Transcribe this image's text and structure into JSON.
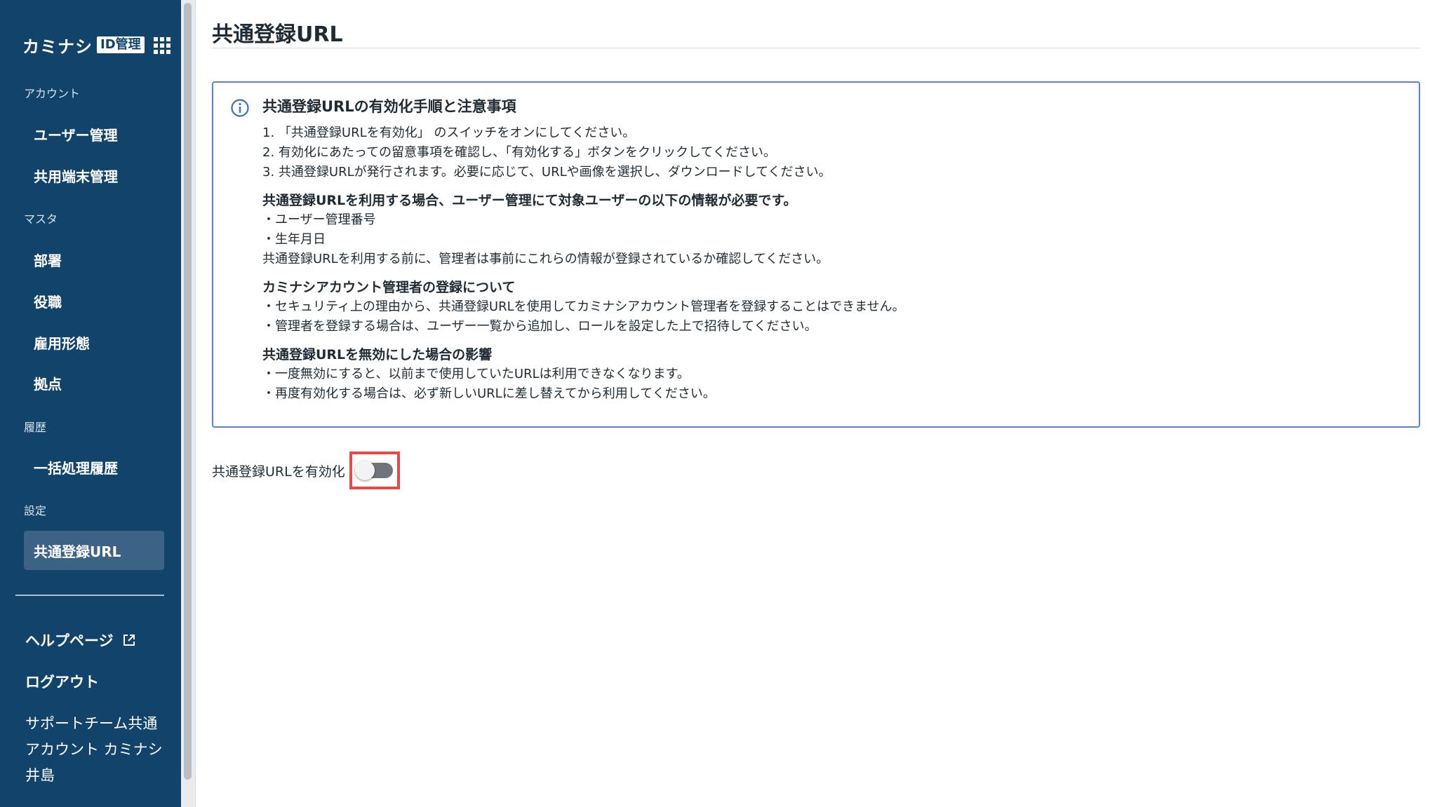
{
  "sidebar": {
    "logo_text": "カミナシ",
    "logo_badge": "ID管理",
    "apps_icon": "grid-icon",
    "sections": {
      "account": "アカウント",
      "master": "マスタ",
      "history": "履歴",
      "settings": "設定"
    },
    "items": {
      "user_management": "ユーザー管理",
      "shared_device_management": "共用端末管理",
      "department": "部署",
      "position": "役職",
      "employment_type": "雇用形態",
      "location": "拠点",
      "batch_history": "一括処理履歴",
      "shared_registration_url": "共通登録URL"
    },
    "active_item": "shared_registration_url",
    "help_page": "ヘルプページ",
    "logout": "ログアウト",
    "user_name": "サポートチーム共通アカウント カミナシ 井島"
  },
  "main": {
    "title": "共通登録URL",
    "info": {
      "heading": "共通登録URLの有効化手順と注意事項",
      "steps": [
        "1. 「共通登録URLを有効化」 のスイッチをオンにしてください。",
        "2. 有効化にあたっての留意事項を確認し、「有効化する」ボタンをクリックしてください。",
        "3. 共通登録URLが発行されます。必要に応じて、URLや画像を選択し、ダウンロードしてください。"
      ],
      "requirements_heading": "共通登録URLを利用する場合、ユーザー管理にて対象ユーザーの以下の情報が必要です。",
      "requirements": [
        "・ユーザー管理番号",
        "・生年月日",
        "共通登録URLを利用する前に、管理者は事前にこれらの情報が登録されているか確認してください。"
      ],
      "admin_heading": "カミナシアカウント管理者の登録について",
      "admin_notes": [
        "・セキュリティ上の理由から、共通登録URLを使用してカミナシアカウント管理者を登録することはできません。",
        "・管理者を登録する場合は、ユーザー一覧から追加し、ロールを設定した上で招待してください。"
      ],
      "disable_heading": "共通登録URLを無効にした場合の影響",
      "disable_notes": [
        "・一度無効にすると、以前まで使用していたURLは利用できなくなります。",
        "・再度有効化する場合は、必ず新しいURLに差し替えてから利用してください。"
      ]
    },
    "toggle": {
      "label": "共通登録URLを有効化",
      "enabled": false
    }
  },
  "colors": {
    "sidebar_bg": "#12436a",
    "active_item_bg": "#3c6385",
    "info_border": "#5b82c6",
    "highlight": "#e9474b"
  }
}
